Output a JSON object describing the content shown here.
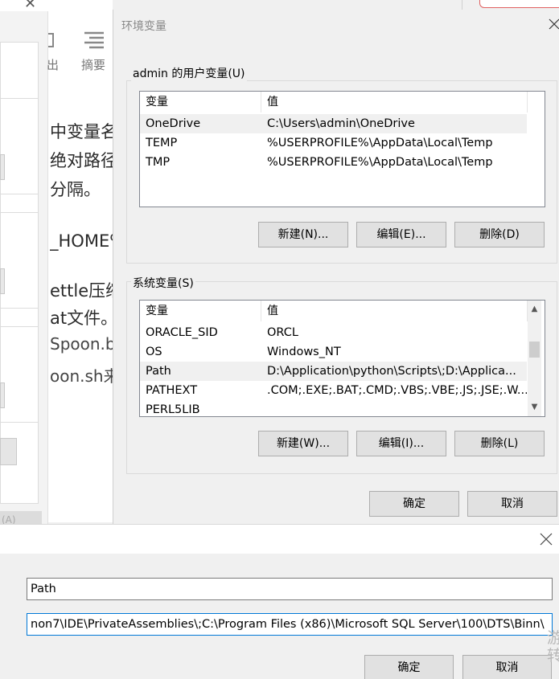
{
  "background_doc": {
    "toolbar_label_partial": "出",
    "toolbar_label": "摘要",
    "lines": [
      "中变量名",
      "绝对路径",
      "分隔。",
      "_HOME%",
      "ettle压缩",
      "at文件。",
      "Spoon.b",
      "oon.sh来"
    ],
    "bottom_partial": "(A)"
  },
  "env_dialog": {
    "title": "环境变量",
    "user_group_label": "admin 的用户变量(U)",
    "system_group_label": "系统变量(S)",
    "columns": [
      "变量",
      "值"
    ],
    "user_vars": [
      {
        "name": "OneDrive",
        "value": "C:\\Users\\admin\\OneDrive"
      },
      {
        "name": "TEMP",
        "value": "%USERPROFILE%\\AppData\\Local\\Temp"
      },
      {
        "name": "TMP",
        "value": "%USERPROFILE%\\AppData\\Local\\Temp"
      }
    ],
    "system_vars": [
      {
        "name": "ORACLE_SID",
        "value": "ORCL"
      },
      {
        "name": "OS",
        "value": "Windows_NT"
      },
      {
        "name": "Path",
        "value": "D:\\Application\\python\\Scripts\\;D:\\Applica..."
      },
      {
        "name": "PATHEXT",
        "value": ".COM;.EXE;.BAT;.CMD;.VBS;.VBE;.JS;.JSE;.W..."
      },
      {
        "name": "PERL5LIB",
        "value": ""
      }
    ],
    "user_buttons": {
      "new": "新建(N)...",
      "edit": "编辑(E)...",
      "delete": "删除(D)"
    },
    "system_buttons": {
      "new": "新建(W)...",
      "edit": "编辑(I)...",
      "delete": "删除(L)"
    },
    "ok": "确定",
    "cancel": "取消"
  },
  "edit_dialog": {
    "var_name": "Path",
    "var_value": "non7\\IDE\\PrivateAssemblies\\;C:\\Program Files (x86)\\Microsoft SQL Server\\100\\DTS\\Binn\\",
    "ok": "确定",
    "cancel": "取消",
    "watermark": "游转"
  }
}
